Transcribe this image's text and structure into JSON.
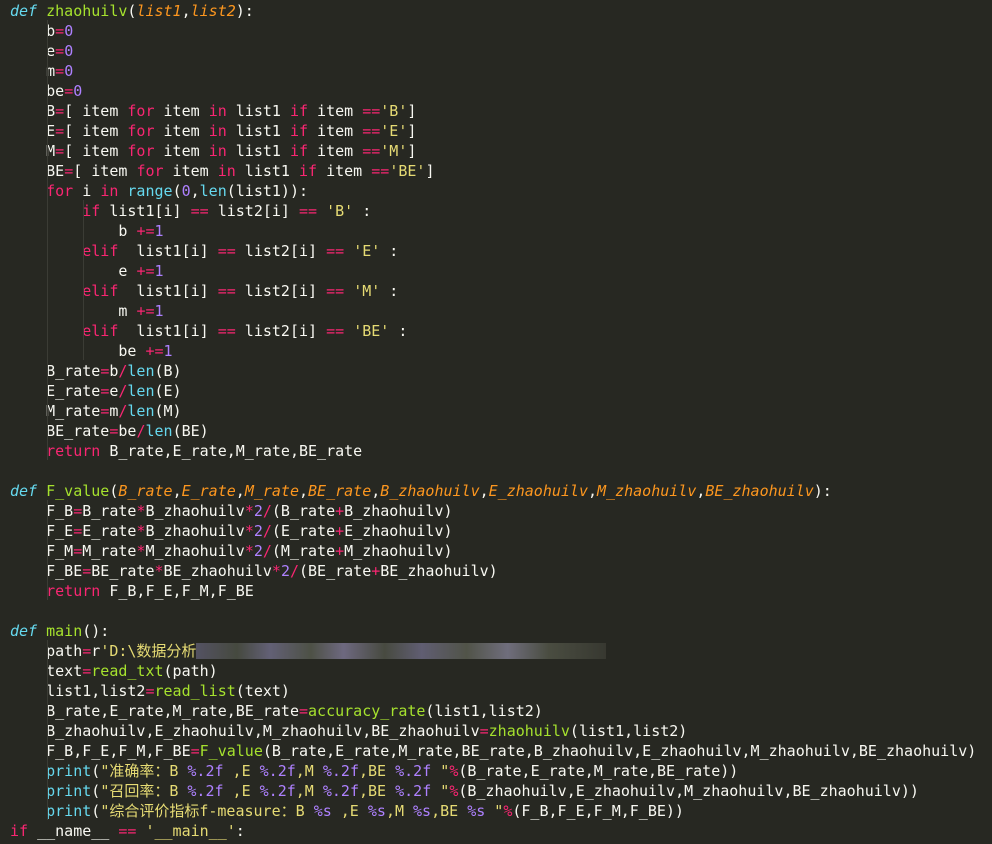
{
  "editor": {
    "theme_colors": {
      "background": "#272822",
      "keyword": "#66d9ef",
      "function": "#a6e22e",
      "parameter": "#fd971f",
      "number": "#ae81ff",
      "operator": "#f92672",
      "string": "#e6db74",
      "text": "#f8f8f2"
    },
    "lines": [
      [
        [
          "kw",
          "def"
        ],
        [
          "var",
          " "
        ],
        [
          "fn",
          "zhaohuilv"
        ],
        [
          "var",
          "("
        ],
        [
          "par",
          "list1"
        ],
        [
          "var",
          ","
        ],
        [
          "par",
          "list2"
        ],
        [
          "var",
          "):"
        ]
      ],
      [
        [
          "var",
          "    b"
        ],
        [
          "op",
          "="
        ],
        [
          "num",
          "0"
        ]
      ],
      [
        [
          "var",
          "    e"
        ],
        [
          "op",
          "="
        ],
        [
          "num",
          "0"
        ]
      ],
      [
        [
          "var",
          "    m"
        ],
        [
          "op",
          "="
        ],
        [
          "num",
          "0"
        ]
      ],
      [
        [
          "var",
          "    be"
        ],
        [
          "op",
          "="
        ],
        [
          "num",
          "0"
        ]
      ],
      [
        [
          "var",
          "    B"
        ],
        [
          "op",
          "="
        ],
        [
          "var",
          "[ item "
        ],
        [
          "ctl",
          "for"
        ],
        [
          "var",
          " item "
        ],
        [
          "ctl",
          "in"
        ],
        [
          "var",
          " list1 "
        ],
        [
          "ctl",
          "if"
        ],
        [
          "var",
          " item "
        ],
        [
          "op",
          "=="
        ],
        [
          "str",
          "'B'"
        ],
        [
          "var",
          "]"
        ]
      ],
      [
        [
          "var",
          "    E"
        ],
        [
          "op",
          "="
        ],
        [
          "var",
          "[ item "
        ],
        [
          "ctl",
          "for"
        ],
        [
          "var",
          " item "
        ],
        [
          "ctl",
          "in"
        ],
        [
          "var",
          " list1 "
        ],
        [
          "ctl",
          "if"
        ],
        [
          "var",
          " item "
        ],
        [
          "op",
          "=="
        ],
        [
          "str",
          "'E'"
        ],
        [
          "var",
          "]"
        ]
      ],
      [
        [
          "var",
          "    M"
        ],
        [
          "op",
          "="
        ],
        [
          "var",
          "[ item "
        ],
        [
          "ctl",
          "for"
        ],
        [
          "var",
          " item "
        ],
        [
          "ctl",
          "in"
        ],
        [
          "var",
          " list1 "
        ],
        [
          "ctl",
          "if"
        ],
        [
          "var",
          " item "
        ],
        [
          "op",
          "=="
        ],
        [
          "str",
          "'M'"
        ],
        [
          "var",
          "]"
        ]
      ],
      [
        [
          "var",
          "    BE"
        ],
        [
          "op",
          "="
        ],
        [
          "var",
          "[ item "
        ],
        [
          "ctl",
          "for"
        ],
        [
          "var",
          " item "
        ],
        [
          "ctl",
          "in"
        ],
        [
          "var",
          " list1 "
        ],
        [
          "ctl",
          "if"
        ],
        [
          "var",
          " item "
        ],
        [
          "op",
          "=="
        ],
        [
          "str",
          "'BE'"
        ],
        [
          "var",
          "]"
        ]
      ],
      [
        [
          "var",
          "    "
        ],
        [
          "ctl",
          "for"
        ],
        [
          "var",
          " i "
        ],
        [
          "ctl",
          "in"
        ],
        [
          "var",
          " "
        ],
        [
          "bi",
          "range"
        ],
        [
          "var",
          "("
        ],
        [
          "num",
          "0"
        ],
        [
          "var",
          ","
        ],
        [
          "bi",
          "len"
        ],
        [
          "var",
          "(list1)):"
        ]
      ],
      [
        [
          "var",
          "        "
        ],
        [
          "ctl",
          "if"
        ],
        [
          "var",
          " list1[i] "
        ],
        [
          "op",
          "=="
        ],
        [
          "var",
          " list2[i] "
        ],
        [
          "op",
          "=="
        ],
        [
          "var",
          " "
        ],
        [
          "str",
          "'B'"
        ],
        [
          "var",
          " :"
        ]
      ],
      [
        [
          "var",
          "            b "
        ],
        [
          "op",
          "+="
        ],
        [
          "num",
          "1"
        ]
      ],
      [
        [
          "var",
          "        "
        ],
        [
          "ctl",
          "elif"
        ],
        [
          "var",
          "  list1[i] "
        ],
        [
          "op",
          "=="
        ],
        [
          "var",
          " list2[i] "
        ],
        [
          "op",
          "=="
        ],
        [
          "var",
          " "
        ],
        [
          "str",
          "'E'"
        ],
        [
          "var",
          " :"
        ]
      ],
      [
        [
          "var",
          "            e "
        ],
        [
          "op",
          "+="
        ],
        [
          "num",
          "1"
        ]
      ],
      [
        [
          "var",
          "        "
        ],
        [
          "ctl",
          "elif"
        ],
        [
          "var",
          "  list1[i] "
        ],
        [
          "op",
          "=="
        ],
        [
          "var",
          " list2[i] "
        ],
        [
          "op",
          "=="
        ],
        [
          "var",
          " "
        ],
        [
          "str",
          "'M'"
        ],
        [
          "var",
          " :"
        ]
      ],
      [
        [
          "var",
          "            m "
        ],
        [
          "op",
          "+="
        ],
        [
          "num",
          "1"
        ]
      ],
      [
        [
          "var",
          "        "
        ],
        [
          "ctl",
          "elif"
        ],
        [
          "var",
          "  list1[i] "
        ],
        [
          "op",
          "=="
        ],
        [
          "var",
          " list2[i] "
        ],
        [
          "op",
          "=="
        ],
        [
          "var",
          " "
        ],
        [
          "str",
          "'BE'"
        ],
        [
          "var",
          " :"
        ]
      ],
      [
        [
          "var",
          "            be "
        ],
        [
          "op",
          "+="
        ],
        [
          "num",
          "1"
        ]
      ],
      [
        [
          "var",
          "    B_rate"
        ],
        [
          "op",
          "="
        ],
        [
          "var",
          "b"
        ],
        [
          "op",
          "/"
        ],
        [
          "bi",
          "len"
        ],
        [
          "var",
          "(B)"
        ]
      ],
      [
        [
          "var",
          "    E_rate"
        ],
        [
          "op",
          "="
        ],
        [
          "var",
          "e"
        ],
        [
          "op",
          "/"
        ],
        [
          "bi",
          "len"
        ],
        [
          "var",
          "(E)"
        ]
      ],
      [
        [
          "var",
          "    M_rate"
        ],
        [
          "op",
          "="
        ],
        [
          "var",
          "m"
        ],
        [
          "op",
          "/"
        ],
        [
          "bi",
          "len"
        ],
        [
          "var",
          "(M)"
        ]
      ],
      [
        [
          "var",
          "    BE_rate"
        ],
        [
          "op",
          "="
        ],
        [
          "var",
          "be"
        ],
        [
          "op",
          "/"
        ],
        [
          "bi",
          "len"
        ],
        [
          "var",
          "(BE)"
        ]
      ],
      [
        [
          "var",
          "    "
        ],
        [
          "ctl",
          "return"
        ],
        [
          "var",
          " B_rate,E_rate,M_rate,BE_rate"
        ]
      ],
      [],
      [
        [
          "kw",
          "def"
        ],
        [
          "var",
          " "
        ],
        [
          "fn",
          "F_value"
        ],
        [
          "var",
          "("
        ],
        [
          "par",
          "B_rate"
        ],
        [
          "var",
          ","
        ],
        [
          "par",
          "E_rate"
        ],
        [
          "var",
          ","
        ],
        [
          "par",
          "M_rate"
        ],
        [
          "var",
          ","
        ],
        [
          "par",
          "BE_rate"
        ],
        [
          "var",
          ","
        ],
        [
          "par",
          "B_zhaohuilv"
        ],
        [
          "var",
          ","
        ],
        [
          "par",
          "E_zhaohuilv"
        ],
        [
          "var",
          ","
        ],
        [
          "par",
          "M_zhaohuilv"
        ],
        [
          "var",
          ","
        ],
        [
          "par",
          "BE_zhaohuilv"
        ],
        [
          "var",
          "):"
        ]
      ],
      [
        [
          "var",
          "    F_B"
        ],
        [
          "op",
          "="
        ],
        [
          "var",
          "B_rate"
        ],
        [
          "op",
          "*"
        ],
        [
          "var",
          "B_zhaohuilv"
        ],
        [
          "op",
          "*"
        ],
        [
          "num",
          "2"
        ],
        [
          "op",
          "/"
        ],
        [
          "var",
          "(B_rate"
        ],
        [
          "op",
          "+"
        ],
        [
          "var",
          "B_zhaohuilv)"
        ]
      ],
      [
        [
          "var",
          "    F_E"
        ],
        [
          "op",
          "="
        ],
        [
          "var",
          "E_rate"
        ],
        [
          "op",
          "*"
        ],
        [
          "var",
          "B_zhaohuilv"
        ],
        [
          "op",
          "*"
        ],
        [
          "num",
          "2"
        ],
        [
          "op",
          "/"
        ],
        [
          "var",
          "(E_rate"
        ],
        [
          "op",
          "+"
        ],
        [
          "var",
          "E_zhaohuilv)"
        ]
      ],
      [
        [
          "var",
          "    F_M"
        ],
        [
          "op",
          "="
        ],
        [
          "var",
          "M_rate"
        ],
        [
          "op",
          "*"
        ],
        [
          "var",
          "M_zhaohuilv"
        ],
        [
          "op",
          "*"
        ],
        [
          "num",
          "2"
        ],
        [
          "op",
          "/"
        ],
        [
          "var",
          "(M_rate"
        ],
        [
          "op",
          "+"
        ],
        [
          "var",
          "M_zhaohuilv)"
        ]
      ],
      [
        [
          "var",
          "    F_BE"
        ],
        [
          "op",
          "="
        ],
        [
          "var",
          "BE_rate"
        ],
        [
          "op",
          "*"
        ],
        [
          "var",
          "BE_zhaohuilv"
        ],
        [
          "op",
          "*"
        ],
        [
          "num",
          "2"
        ],
        [
          "op",
          "/"
        ],
        [
          "var",
          "(BE_rate"
        ],
        [
          "op",
          "+"
        ],
        [
          "var",
          "BE_zhaohuilv)"
        ]
      ],
      [
        [
          "var",
          "    "
        ],
        [
          "ctl",
          "return"
        ],
        [
          "var",
          " F_B,F_E,F_M,F_BE"
        ]
      ],
      [],
      [
        [
          "kw",
          "def"
        ],
        [
          "var",
          " "
        ],
        [
          "fn",
          "main"
        ],
        [
          "var",
          "():"
        ]
      ],
      [
        [
          "var",
          "    path"
        ],
        [
          "op",
          "="
        ],
        [
          "var",
          "r"
        ],
        [
          "str",
          "'D:\\数据分析"
        ],
        [
          "blur",
          ""
        ]
      ],
      [
        [
          "var",
          "    text"
        ],
        [
          "op",
          "="
        ],
        [
          "fn",
          "read_txt"
        ],
        [
          "var",
          "(path)"
        ]
      ],
      [
        [
          "var",
          "    list1,list2"
        ],
        [
          "op",
          "="
        ],
        [
          "fn",
          "read_list"
        ],
        [
          "var",
          "(text)"
        ]
      ],
      [
        [
          "var",
          "    B_rate,E_rate,M_rate,BE_rate"
        ],
        [
          "op",
          "="
        ],
        [
          "fn",
          "accuracy_rate"
        ],
        [
          "var",
          "(list1,list2)"
        ]
      ],
      [
        [
          "var",
          "    B_zhaohuilv,E_zhaohuilv,M_zhaohuilv,BE_zhaohuilv"
        ],
        [
          "op",
          "="
        ],
        [
          "fn",
          "zhaohuilv"
        ],
        [
          "var",
          "(list1,list2)"
        ]
      ],
      [
        [
          "var",
          "    F_B,F_E,F_M,F_BE"
        ],
        [
          "op",
          "="
        ],
        [
          "fn",
          "F_value"
        ],
        [
          "var",
          "(B_rate,E_rate,M_rate,BE_rate,B_zhaohuilv,E_zhaohuilv,M_zhaohuilv,BE_zhaohuilv)"
        ]
      ],
      [
        [
          "var",
          "    "
        ],
        [
          "bi",
          "print"
        ],
        [
          "var",
          "("
        ],
        [
          "str",
          "\"准确率：B "
        ],
        [
          "num",
          "%.2f"
        ],
        [
          "str",
          " ,E "
        ],
        [
          "num",
          "%.2f"
        ],
        [
          "str",
          ",M "
        ],
        [
          "num",
          "%.2f"
        ],
        [
          "str",
          ",BE "
        ],
        [
          "num",
          "%.2f"
        ],
        [
          "str",
          " \""
        ],
        [
          "op",
          "%"
        ],
        [
          "var",
          "(B_rate,E_rate,M_rate,BE_rate))"
        ]
      ],
      [
        [
          "var",
          "    "
        ],
        [
          "bi",
          "print"
        ],
        [
          "var",
          "("
        ],
        [
          "str",
          "\"召回率：B "
        ],
        [
          "num",
          "%.2f"
        ],
        [
          "str",
          " ,E "
        ],
        [
          "num",
          "%.2f"
        ],
        [
          "str",
          ",M "
        ],
        [
          "num",
          "%.2f"
        ],
        [
          "str",
          ",BE "
        ],
        [
          "num",
          "%.2f"
        ],
        [
          "str",
          " \""
        ],
        [
          "op",
          "%"
        ],
        [
          "var",
          "(B_zhaohuilv,E_zhaohuilv,M_zhaohuilv,BE_zhaohuilv))"
        ]
      ],
      [
        [
          "var",
          "    "
        ],
        [
          "bi",
          "print"
        ],
        [
          "var",
          "("
        ],
        [
          "str",
          "\"综合评价指标f-measure：B "
        ],
        [
          "num",
          "%s"
        ],
        [
          "str",
          " ,E "
        ],
        [
          "num",
          "%s"
        ],
        [
          "str",
          ",M "
        ],
        [
          "num",
          "%s"
        ],
        [
          "str",
          ",BE "
        ],
        [
          "num",
          "%s"
        ],
        [
          "str",
          " \""
        ],
        [
          "op",
          "%"
        ],
        [
          "var",
          "(F_B,F_E,F_M,F_BE))"
        ]
      ],
      [
        [
          "ctl",
          "if"
        ],
        [
          "var",
          " __name__ "
        ],
        [
          "op",
          "=="
        ],
        [
          "var",
          " "
        ],
        [
          "str",
          "'__main__'"
        ],
        [
          "var",
          ":"
        ]
      ]
    ]
  }
}
